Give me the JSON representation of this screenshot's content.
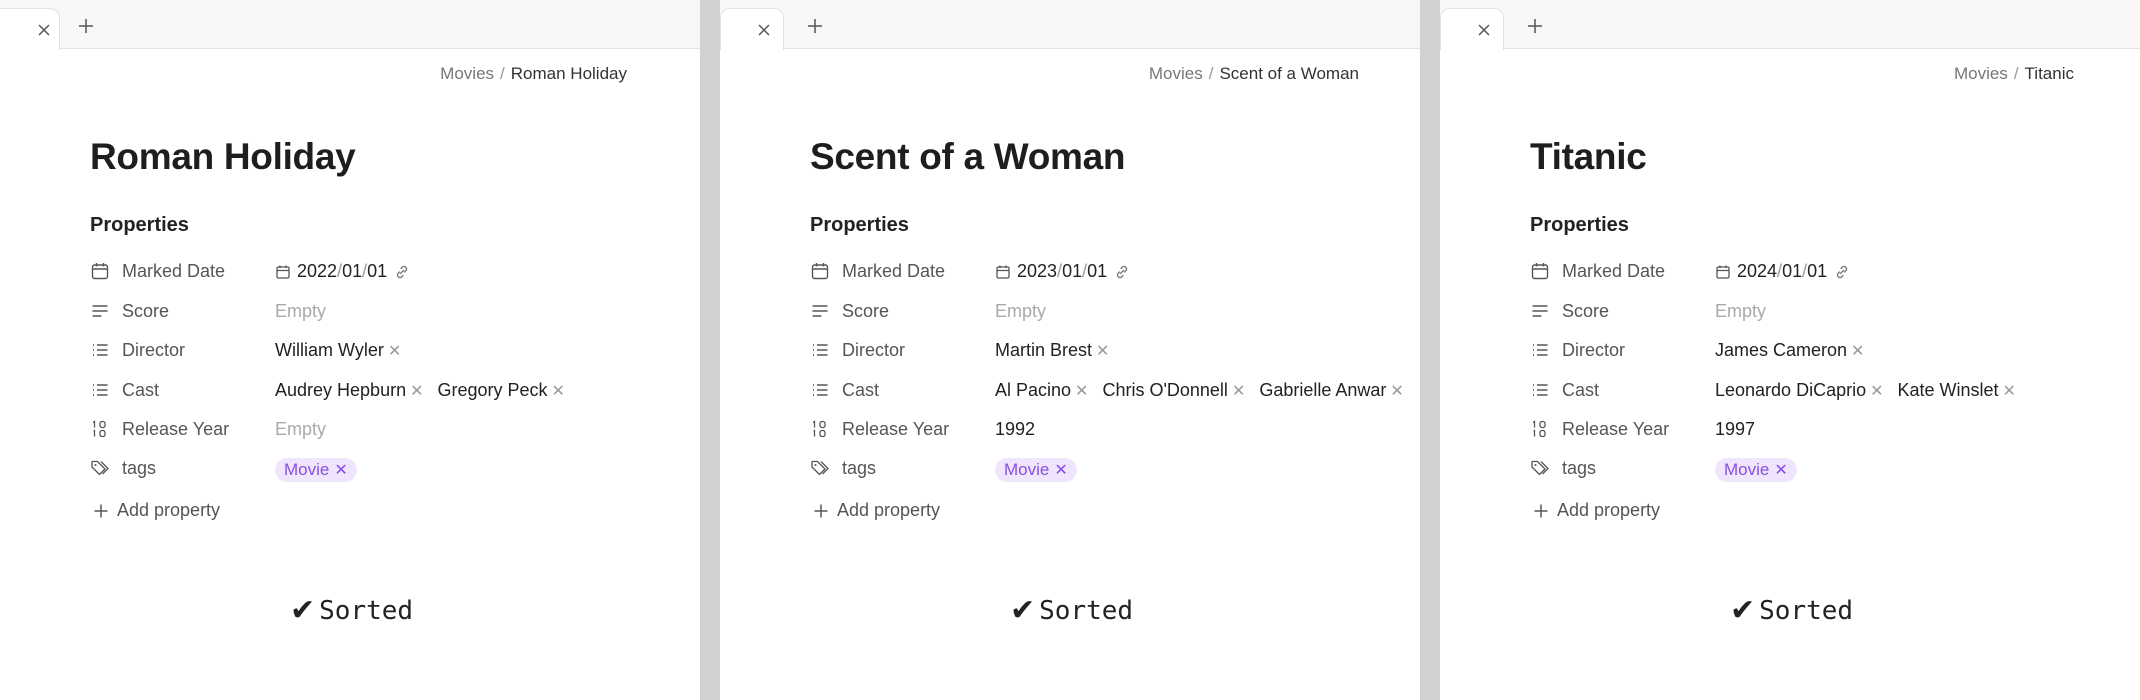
{
  "breadcrumb_root": "Movies",
  "properties_heading": "Properties",
  "labels": {
    "marked_date": "Marked Date",
    "score": "Score",
    "director": "Director",
    "cast": "Cast",
    "release_year": "Release Year",
    "tags": "tags"
  },
  "add_property": "Add property",
  "sorted_text": "Sorted",
  "sorted_check": "✔",
  "empty_text": "Empty",
  "remove_glyph": "✕",
  "pill_color": "#8a4ee6",
  "pill_bg": "#efe6fd",
  "pages": [
    {
      "title": "Roman Holiday",
      "marked_date": {
        "y": "2022",
        "m": "01",
        "d": "01"
      },
      "score": "Empty",
      "director": [
        "William Wyler"
      ],
      "cast": [
        "Audrey Hepburn",
        "Gregory Peck"
      ],
      "release_year": "Empty",
      "release_year_empty": true,
      "tags": [
        "Movie"
      ]
    },
    {
      "title": "Scent of a Woman",
      "marked_date": {
        "y": "2023",
        "m": "01",
        "d": "01"
      },
      "score": "Empty",
      "director": [
        "Martin Brest"
      ],
      "cast": [
        "Al Pacino",
        "Chris O'Donnell",
        "Gabrielle Anwar"
      ],
      "release_year": "1992",
      "release_year_empty": false,
      "tags": [
        "Movie"
      ]
    },
    {
      "title": "Titanic",
      "marked_date": {
        "y": "2024",
        "m": "01",
        "d": "01"
      },
      "score": "Empty",
      "director": [
        "James Cameron"
      ],
      "cast": [
        "Leonardo DiCaprio",
        "Kate Winslet"
      ],
      "release_year": "1997",
      "release_year_empty": false,
      "tags": [
        "Movie"
      ]
    }
  ]
}
